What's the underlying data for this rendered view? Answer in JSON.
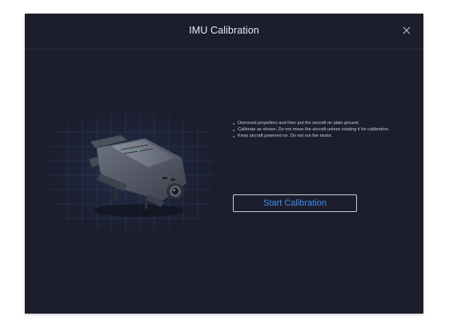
{
  "dialog": {
    "title": "IMU Calibration",
    "close_icon": "close-icon"
  },
  "illustration": {
    "icon": "drone-icon",
    "grid_color": "#2f4b7a"
  },
  "instructions": [
    "Dismount propellers and then put the aircraft on plain ground.",
    "Calibrate as shown. Do not move the aircraft unless rotating it for calibration.",
    "Keep aircraft powered on. Do not run the motor."
  ],
  "actions": {
    "start_label": "Start Calibration",
    "accent_color": "#3e8ef0"
  }
}
